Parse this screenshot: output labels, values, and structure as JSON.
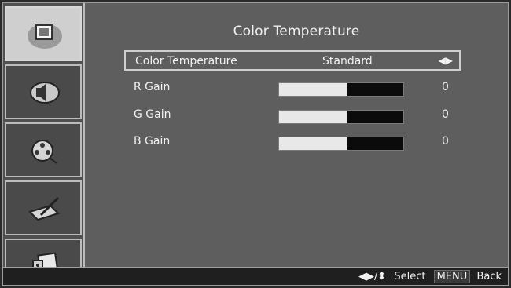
{
  "title": "Color Temperature",
  "sidebar": {
    "items": [
      {
        "icon": "picture-icon",
        "active": true
      },
      {
        "icon": "sound-icon",
        "active": false
      },
      {
        "icon": "setup-icon",
        "active": false
      },
      {
        "icon": "tools-icon",
        "active": false
      },
      {
        "icon": "input-icon",
        "active": false
      }
    ]
  },
  "rows": [
    {
      "label": "Color Temperature",
      "value": "Standard",
      "arrows": "◀▶",
      "selected": true
    },
    {
      "label": "R Gain",
      "level": 0.55,
      "number": "0"
    },
    {
      "label": "G Gain",
      "level": 0.55,
      "number": "0"
    },
    {
      "label": "B Gain",
      "level": 0.55,
      "number": "0"
    }
  ],
  "help": {
    "nav_icons": "◀▶/⬍",
    "select_label": "Select",
    "menu_key": "MENU",
    "back_label": "Back"
  },
  "colors": {
    "background": "#5e5e5e",
    "sidebar": "#505050",
    "active": "#cfcfcf"
  }
}
